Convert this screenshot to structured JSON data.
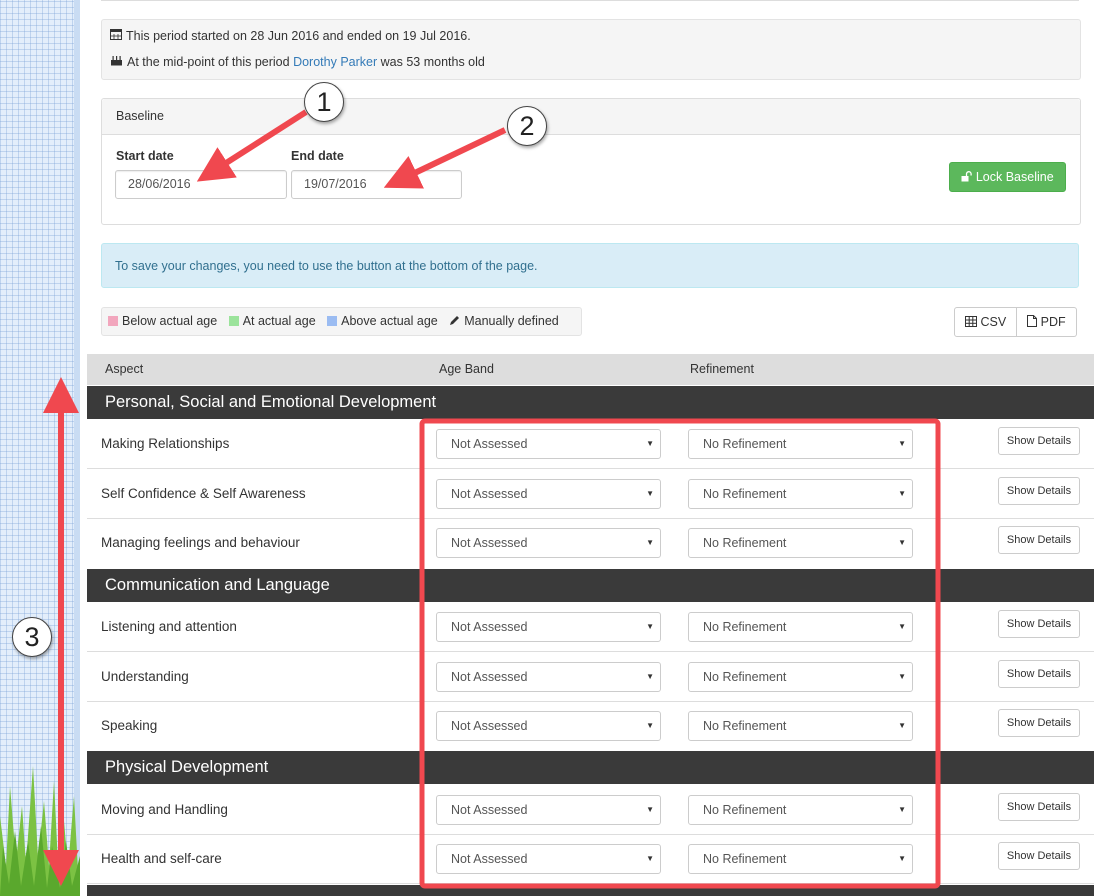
{
  "period": {
    "line1": "This period started on 28 Jun 2016 and ended on 19 Jul 2016.",
    "line2_prefix": "At the mid-point of this period",
    "child_name": "Dorothy Parker",
    "line2_suffix": "was 53 months old"
  },
  "baseline": {
    "title": "Baseline",
    "start_label": "Start date",
    "start_value": "28/06/2016",
    "end_label": "End date",
    "end_value": "19/07/2016",
    "lock_label": "Lock Baseline"
  },
  "alert": {
    "text": "To save your changes, you need to use the button at the bottom of the page."
  },
  "legend": {
    "items": [
      {
        "label": "Below actual age",
        "color": "#f2a6bd"
      },
      {
        "label": "At actual age",
        "color": "#9be39b"
      },
      {
        "label": "Above actual age",
        "color": "#9bbcf2"
      },
      {
        "label": "Manually defined",
        "color": ""
      }
    ]
  },
  "export": {
    "csv": "CSV",
    "pdf": "PDF"
  },
  "table": {
    "headers": {
      "aspect": "Aspect",
      "age_band": "Age Band",
      "refinement": "Refinement"
    },
    "sections": [
      "Personal, Social and Emotional Development",
      "Communication and Language",
      "Physical Development"
    ],
    "rows": [
      {
        "aspect": "Making Relationships",
        "age_band": "Not Assessed",
        "refinement": "No Refinement",
        "details": "Show Details"
      },
      {
        "aspect": "Self Confidence & Self Awareness",
        "age_band": "Not Assessed",
        "refinement": "No Refinement",
        "details": "Show Details"
      },
      {
        "aspect": "Managing feelings and behaviour",
        "age_band": "Not Assessed",
        "refinement": "No Refinement",
        "details": "Show Details"
      },
      {
        "aspect": "Listening and attention",
        "age_band": "Not Assessed",
        "refinement": "No Refinement",
        "details": "Show Details"
      },
      {
        "aspect": "Understanding",
        "age_band": "Not Assessed",
        "refinement": "No Refinement",
        "details": "Show Details"
      },
      {
        "aspect": "Speaking",
        "age_band": "Not Assessed",
        "refinement": "No Refinement",
        "details": "Show Details"
      },
      {
        "aspect": "Moving and Handling",
        "age_band": "Not Assessed",
        "refinement": "No Refinement",
        "details": "Show Details"
      },
      {
        "aspect": "Health and self-care",
        "age_band": "Not Assessed",
        "refinement": "No Refinement",
        "details": "Show Details"
      }
    ]
  },
  "annotations": {
    "one": "1",
    "two": "2",
    "three": "3"
  },
  "colors": {
    "arrow": "#f0484f",
    "success": "#5cb85c",
    "section_bg": "#3a3a3a"
  }
}
